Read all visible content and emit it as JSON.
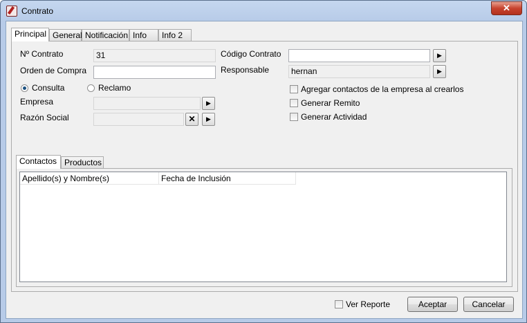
{
  "window": {
    "title": "Contrato",
    "close_glyph": "✕"
  },
  "tabs": [
    "Principal",
    "General",
    "Notificación",
    "Info",
    "Info 2"
  ],
  "principal": {
    "nro_contrato_label": "Nº Contrato",
    "nro_contrato_value": "31",
    "orden_compra_label": "Orden de Compra",
    "orden_compra_value": "",
    "codigo_contrato_label": "Código Contrato",
    "codigo_contrato_value": "",
    "responsable_label": "Responsable",
    "responsable_value": "hernan",
    "tipo_consulta_label": "Consulta",
    "tipo_reclamo_label": "Reclamo",
    "tipo_selected": "Consulta",
    "empresa_label": "Empresa",
    "empresa_value": "",
    "razon_social_label": "Razón Social",
    "razon_social_value": "",
    "chk_agregar_label": "Agregar contactos de la empresa al crearlos",
    "chk_remito_label": "Generar Remito",
    "chk_actividad_label": "Generar Actividad",
    "arrow_glyph": "▶",
    "clear_glyph": "✕"
  },
  "subtabs": [
    "Contactos",
    "Productos"
  ],
  "contactos_grid": {
    "columns": [
      "Apellido(s) y Nombre(s)",
      "Fecha de Inclusión"
    ],
    "rows": []
  },
  "footer": {
    "ver_reporte_label": "Ver Reporte",
    "aceptar_label": "Aceptar",
    "cancelar_label": "Cancelar"
  }
}
